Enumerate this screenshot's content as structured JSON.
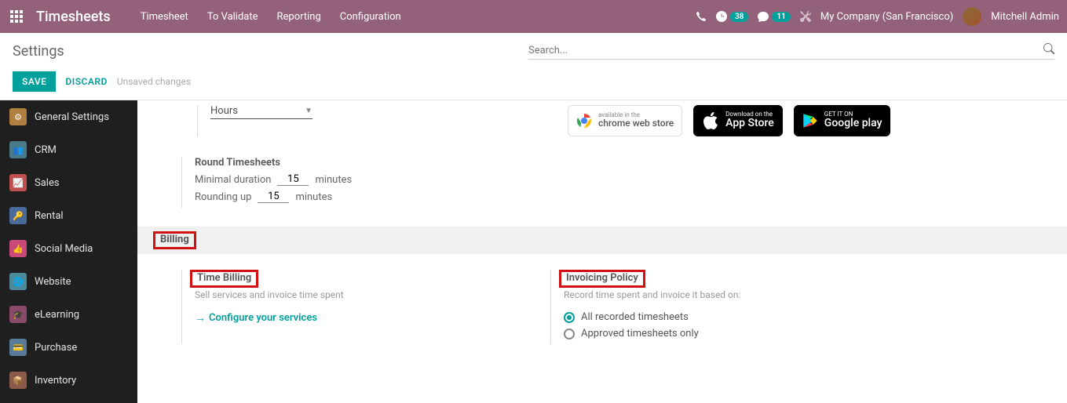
{
  "topbar": {
    "app_name": "Timesheets",
    "menu": [
      "Timesheet",
      "To Validate",
      "Reporting",
      "Configuration"
    ],
    "activities_count": "38",
    "messages_count": "11",
    "company": "My Company (San Francisco)",
    "user": "Mitchell Admin"
  },
  "control_panel": {
    "title": "Settings",
    "search_placeholder": "Search...",
    "save_label": "SAVE",
    "discard_label": "DISCARD",
    "status": "Unsaved changes"
  },
  "sidebar": {
    "items": [
      {
        "label": "General Settings"
      },
      {
        "label": "CRM"
      },
      {
        "label": "Sales"
      },
      {
        "label": "Rental"
      },
      {
        "label": "Social Media"
      },
      {
        "label": "Website"
      },
      {
        "label": "eLearning"
      },
      {
        "label": "Purchase"
      },
      {
        "label": "Inventory"
      }
    ]
  },
  "content": {
    "encoding_value": "Hours",
    "chrome_small": "available in the",
    "chrome_big": "chrome web store",
    "appstore_small": "Download on the",
    "appstore_big": "App Store",
    "play_small": "GET IT ON",
    "play_big": "Google play",
    "round_title": "Round Timesheets",
    "min_dur_label": "Minimal duration",
    "min_dur_value": "15",
    "min_dur_unit": "minutes",
    "rounding_label": "Rounding up",
    "rounding_value": "15",
    "rounding_unit": "minutes",
    "billing_section": "Billing",
    "time_billing_title": "Time Billing",
    "time_billing_desc": "Sell services and invoice time spent",
    "configure_link": "Configure your services",
    "invoicing_title": "Invoicing Policy",
    "invoicing_desc": "Record time spent and invoice it based on:",
    "radio_all": "All recorded timesheets",
    "radio_approved": "Approved timesheets only"
  }
}
